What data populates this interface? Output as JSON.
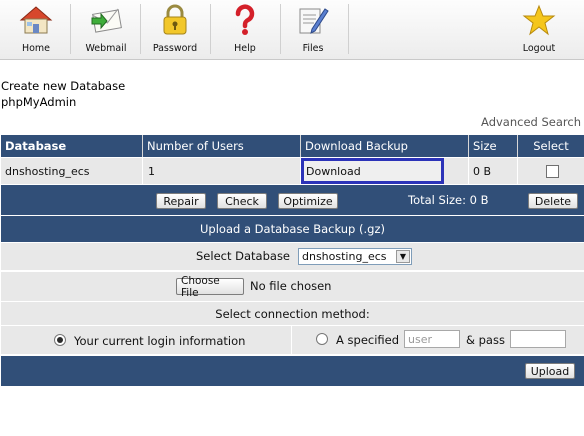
{
  "toolbar": {
    "items": [
      {
        "label": "Home",
        "icon": "home-icon"
      },
      {
        "label": "Webmail",
        "icon": "webmail-icon"
      },
      {
        "label": "Password",
        "icon": "padlock-icon"
      },
      {
        "label": "Help",
        "icon": "question-mark-icon"
      },
      {
        "label": "Files",
        "icon": "files-icon"
      },
      {
        "label": "Logout",
        "icon": "star-icon"
      }
    ]
  },
  "links": {
    "create_db": "Create new Database",
    "phpmyadmin": "phpMyAdmin",
    "advanced_search": "Advanced Search"
  },
  "table": {
    "headers": [
      "Database",
      "Number of Users",
      "Download Backup",
      "Size",
      "Select"
    ],
    "rows": [
      {
        "database": "dnshosting_ecs",
        "users": "1",
        "download": "Download",
        "size": "0 B"
      }
    ]
  },
  "actions": {
    "repair": "Repair",
    "check": "Check",
    "optimize": "Optimize",
    "total_size": "Total Size: 0 B",
    "delete": "Delete"
  },
  "upload": {
    "title": "Upload a Database Backup (.gz)",
    "select_label": "Select Database",
    "select_value": "dnshosting_ecs",
    "choose_file": "Choose File",
    "no_file": "No file chosen",
    "connection_label": "Select connection method:",
    "option_current": "Your current login information",
    "option_specified": "A specified",
    "user_placeholder": "user",
    "and_pass": "& pass",
    "upload_button": "Upload"
  },
  "colors": {
    "header_bg": "#314f78",
    "highlight_border": "#2c33b8"
  }
}
